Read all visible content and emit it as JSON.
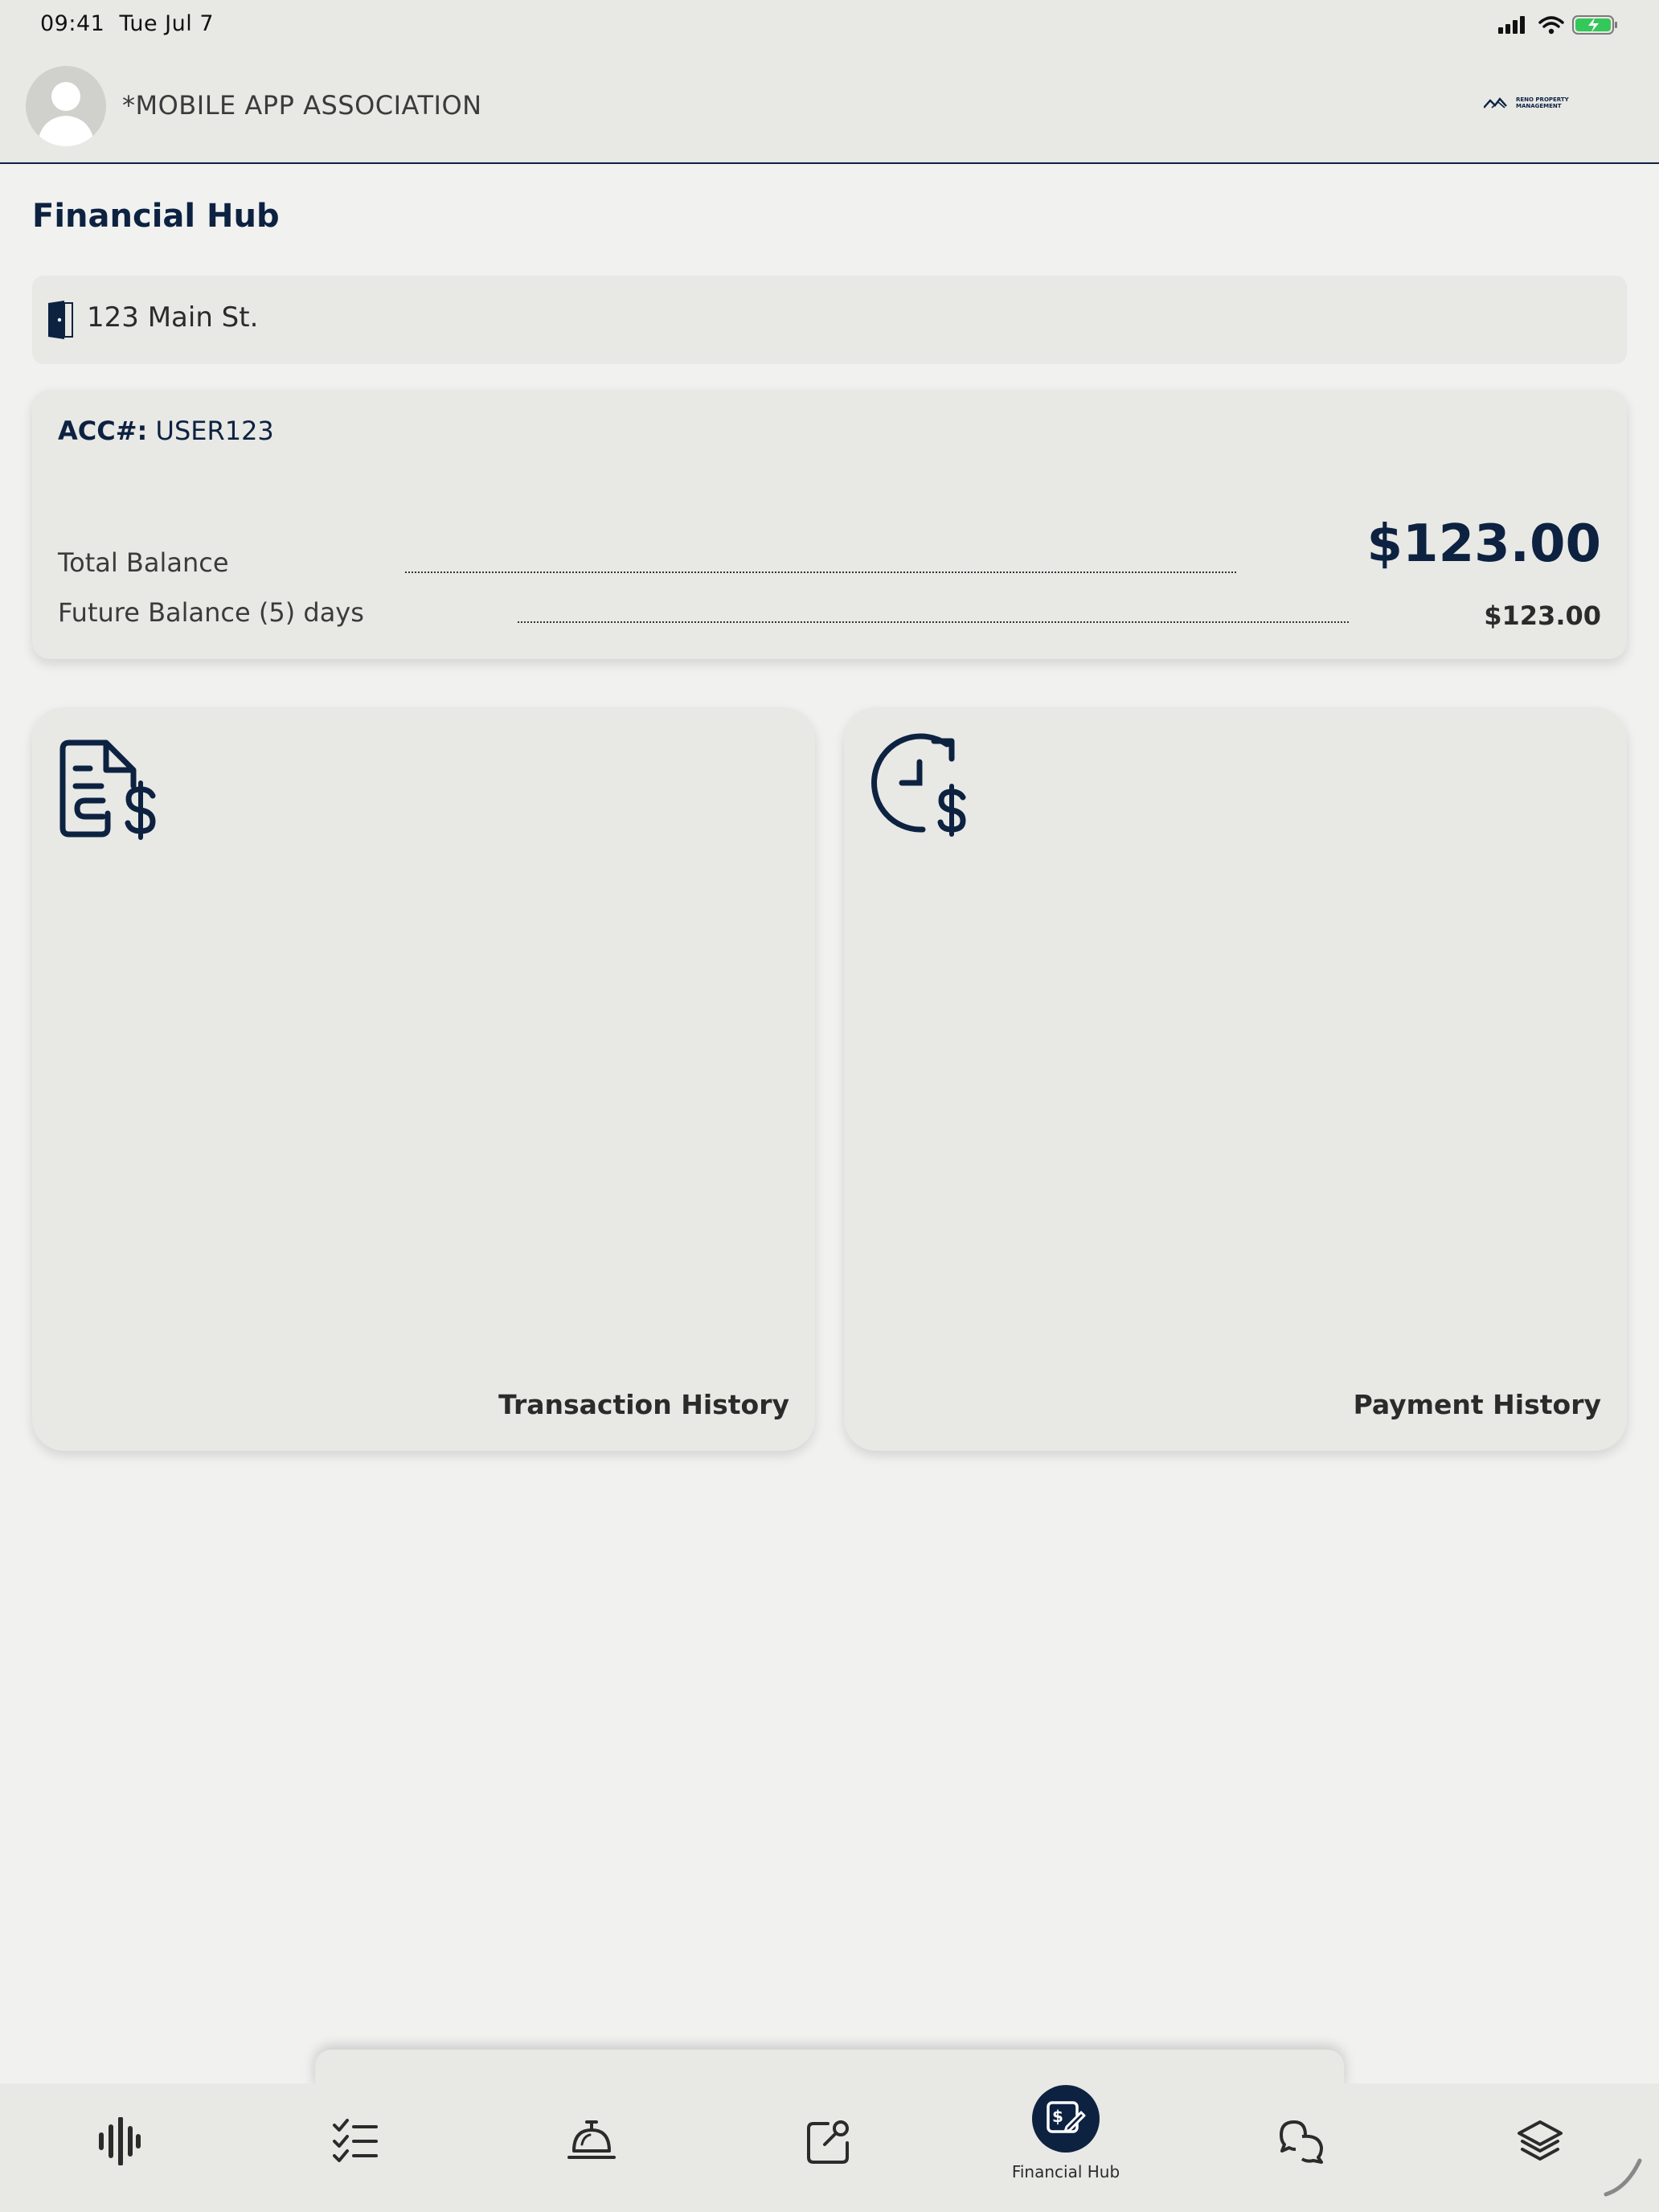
{
  "status_bar": {
    "time": "09:41",
    "date": "Tue Jul 7"
  },
  "header": {
    "association": "*MOBILE APP ASSOCIATION",
    "brand_line1": "RENO PROPERTY",
    "brand_line2": "MANAGEMENT"
  },
  "page": {
    "title": "Financial Hub"
  },
  "address": {
    "text": "123 Main St.",
    "icon": "door-icon"
  },
  "account": {
    "acc_label": "ACC#:",
    "acc_number": "USER123",
    "total_label": "Total Balance",
    "total_value": "$123.00",
    "future_label": "Future Balance",
    "future_days": "(5)",
    "future_days_suffix": "days",
    "future_value": "$123.00"
  },
  "tiles": [
    {
      "label": "Transaction History",
      "icon": "invoice-dollar-icon"
    },
    {
      "label": "Payment History",
      "icon": "clock-dollar-icon"
    }
  ],
  "nav": {
    "items": [
      {
        "icon": "voice-wave-icon"
      },
      {
        "icon": "checklist-icon"
      },
      {
        "icon": "service-bell-icon"
      },
      {
        "icon": "edit-square-icon"
      },
      {
        "icon": "financial-hub-icon",
        "label": "Financial Hub",
        "active": true
      },
      {
        "icon": "chat-bubbles-icon"
      },
      {
        "icon": "layers-icon"
      }
    ]
  },
  "colors": {
    "primary": "#0d2241",
    "surface": "#e8e8e5",
    "background": "#f1f1f0",
    "battery": "#34c759"
  }
}
